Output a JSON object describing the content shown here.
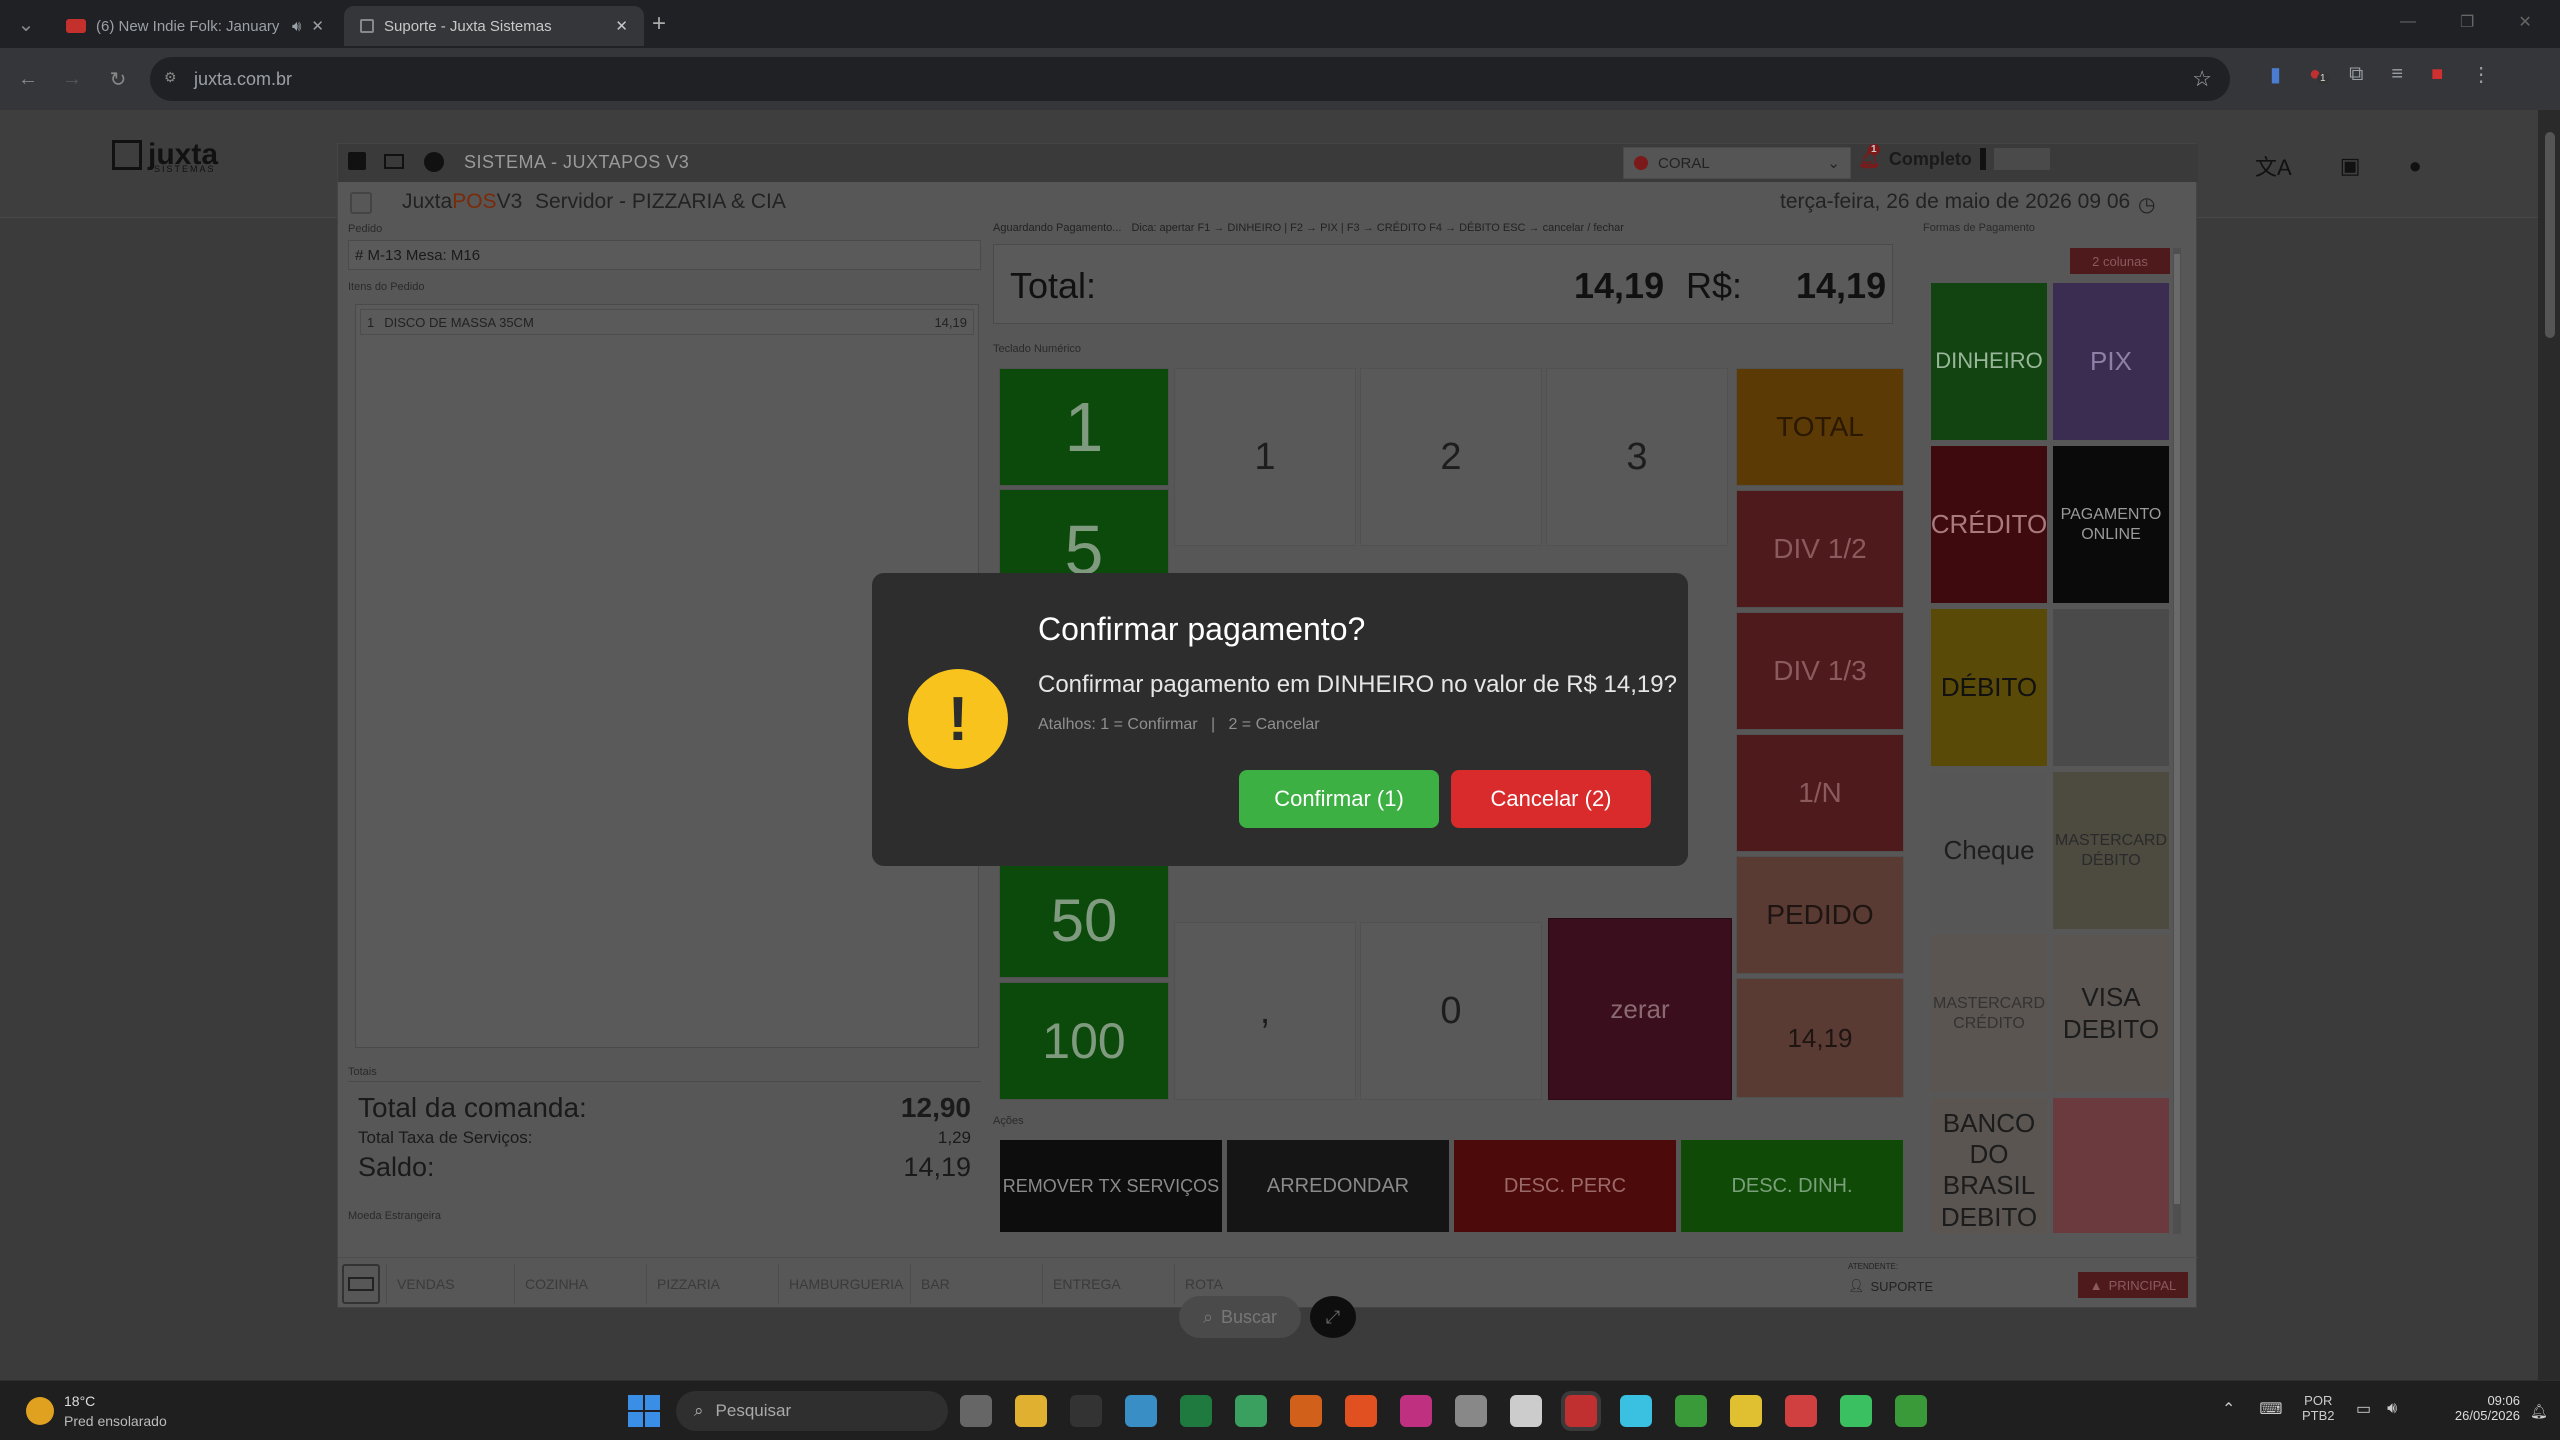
{
  "browser": {
    "tabs": [
      {
        "title": "(6) New Indie Folk: January",
        "active": false
      },
      {
        "title": "Suporte - Juxta Sistemas",
        "active": true
      }
    ],
    "url": "juxta.com.br",
    "ext_badge": "1"
  },
  "site": {
    "logo_text": "juxta",
    "logo_sub": "SISTEMAS",
    "overlay_notice": {
      "count": "1",
      "label": "Completo"
    }
  },
  "pos": {
    "title": "SISTEMA - JUXTAPOS V3",
    "store_selector": "CORAL",
    "brand_juxta": "Juxta",
    "brand_pos": "POS",
    "brand_v3": "V3",
    "server": "Servidor - PIZZARIA & CIA",
    "datetime": "terça-feira, 26 de maio de 2026 09 06",
    "left": {
      "pedido_label": "Pedido",
      "pedido_value": "# M-13 Mesa: M16",
      "itens_label": "Itens do Pedido",
      "items": [
        {
          "qty": "1",
          "name": "DISCO DE MASSA 35CM",
          "price": "14,19"
        }
      ],
      "totais_label": "Totais",
      "total_comanda_label": "Total da comanda:",
      "total_comanda_value": "12,90",
      "taxa_label": "Total Taxa de Serviços:",
      "taxa_value": "1,29",
      "saldo_label": "Saldo:",
      "saldo_value": "14,19",
      "moeda_label": "Moeda Estrangeira"
    },
    "center": {
      "status": "Aguardando Pagamento...",
      "hint": "Dica: apertar F1 → DINHEIRO | F2 → PIX | F3 → CRÉDITO F4 → DÉBITO ESC → cancelar / fechar",
      "total_label": "Total:",
      "total_value": "14,19",
      "currency": "R$:",
      "received_value": "14,19",
      "keypad_label": "Teclado Numérico",
      "quick_keys": [
        "1",
        "5",
        "50",
        "100"
      ],
      "keys": {
        "k1": "1",
        "k2": "2",
        "k3": "3",
        "comma": ",",
        "k0": "0",
        "zerar": "zerar"
      },
      "side_keys": [
        "TOTAL",
        "DIV 1/2",
        "DIV 1/3",
        "1/N",
        "PEDIDO",
        "14,19"
      ],
      "actions_label": "Ações",
      "actions": [
        "REMOVER TX SERVIÇOS",
        "ARREDONDAR",
        "DESC. PERC",
        "DESC. DINH."
      ]
    },
    "right": {
      "label": "Formas de Pagamento",
      "columns_button": "2 colunas",
      "methods": [
        {
          "label": "DINHEIRO",
          "color": "#124412",
          "text": "#9ab69a"
        },
        {
          "label": "PIX",
          "color": "#3b2d52",
          "text": "#8e7fa7"
        },
        {
          "label": "CRÉDITO",
          "color": "#3f0a0e",
          "text": "#a87a7d"
        },
        {
          "label": "PAGAMENTO ONLINE",
          "color": "#0a0a0a",
          "text": "#9a9a9a"
        },
        {
          "label": "DÉBITO",
          "color": "#5a4a08",
          "text": "#111111"
        },
        {
          "label": "",
          "color": "#4a4a4a",
          "text": "#555555"
        },
        {
          "label": "Cheque",
          "color": "#565656",
          "text": "#1e1e1e"
        },
        {
          "label": "MASTERCARD DÉBITO",
          "color": "#4d4a40",
          "text": "#2a2a2a"
        },
        {
          "label": "MASTERCARD CRÉDITO",
          "color": "#5a5551",
          "text": "#333333"
        },
        {
          "label": "VISA DEBITO",
          "color": "#5a5551",
          "text": "#1c1c1c"
        },
        {
          "label": "BANCO DO BRASIL DEBITO",
          "color": "#5a5551",
          "text": "#1c1c1c"
        },
        {
          "label": "",
          "color": "#6a3a3f",
          "text": "#6a3a3f"
        }
      ]
    },
    "bottom_tabs": [
      "VENDAS",
      "COZINHA",
      "PIZZARIA",
      "HAMBURGUERIA",
      "BAR",
      "ENTREGA",
      "ROTA"
    ],
    "attendant_label": "ATENDENTE:",
    "attendant": "SUPORTE",
    "principal": "PRINCIPAL"
  },
  "search_pill": "Buscar",
  "modal": {
    "icon": "!",
    "title": "Confirmar pagamento?",
    "message": "Confirmar pagamento em DINHEIRO no valor de R$ 14,19?",
    "hint": "Atalhos: 1 = Confirmar   |   2 = Cancelar",
    "confirm": "Confirmar (1)",
    "cancel": "Cancelar (2)",
    "confirm_color": "#3cb043",
    "cancel_color": "#d92b2b"
  },
  "taskbar": {
    "weather_temp": "18°C",
    "weather_desc": "Pred ensolarado",
    "search_placeholder": "Pesquisar",
    "lang": "POR",
    "layout": "PTB2",
    "time": "09:06",
    "date": "26/05/2026"
  }
}
